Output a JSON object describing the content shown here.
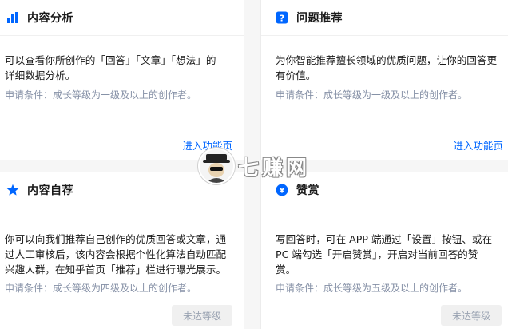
{
  "cards": {
    "content_analysis": {
      "title": "内容分析",
      "icon": "bar-chart-icon",
      "desc_line1": "可以查看你所创作的「回答」「文章」「想法」的",
      "desc_line2": "详细数据分析。",
      "condition": "申请条件：成长等级为一级及以上的创作者。",
      "action": "进入功能页"
    },
    "question_recommend": {
      "title": "问题推荐",
      "icon": "question-mark-icon",
      "desc_line1": "为你智能推荐擅长领域的优质问题，让你的回答更",
      "desc_line2": "有价值。",
      "condition": "申请条件：成长等级为一级及以上的创作者。",
      "action": "进入功能页"
    },
    "self_recommend": {
      "title": "内容自荐",
      "icon": "star-icon",
      "desc_line1": "你可以向我们推荐自己创作的优质回答或文章，通",
      "desc_line2": "过人工审核后，该内容会根据个性化算法自动匹配",
      "desc_line3": "兴趣人群，在知乎首页「推荐」栏进行曝光展示。",
      "condition": "申请条件：成长等级为四级及以上的创作者。",
      "action": "未达等级"
    },
    "appreciate": {
      "title": "赞赏",
      "icon": "coin-icon",
      "desc_line1": "写回答时，可在 APP 端通过「设置」按钮、或在",
      "desc_line2": "PC 端勾选「开启赞赏」，开启对当前回答的赞",
      "desc_line3": "赏。",
      "condition": "申请条件：成长等级为五级及以上的创作者。",
      "action": "未达等级"
    }
  },
  "watermark": {
    "text": "七赚网"
  },
  "colors": {
    "accent": "#0066ff",
    "muted": "#8590a6",
    "disabled_bg": "#f0f0f0"
  }
}
